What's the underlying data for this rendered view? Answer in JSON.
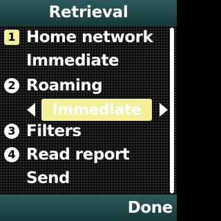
{
  "header": {
    "title": "Retrieval"
  },
  "settings": [
    {
      "number": "1",
      "label": "Home network",
      "value": "Immediate"
    },
    {
      "number": "2",
      "label": "Roaming",
      "value": "Immediate"
    },
    {
      "number": "3",
      "label": "Filters"
    },
    {
      "number": "4",
      "label": "Read report",
      "value": "Send"
    }
  ],
  "softkeys": {
    "right": "Done"
  },
  "icons": {
    "prev": "arrow-left-icon",
    "next": "arrow-right-icon"
  },
  "colors": {
    "title_bar": "#1f4747",
    "highlight": "#f2f099",
    "text": "#ffffff",
    "background": "#0c0c0c"
  }
}
